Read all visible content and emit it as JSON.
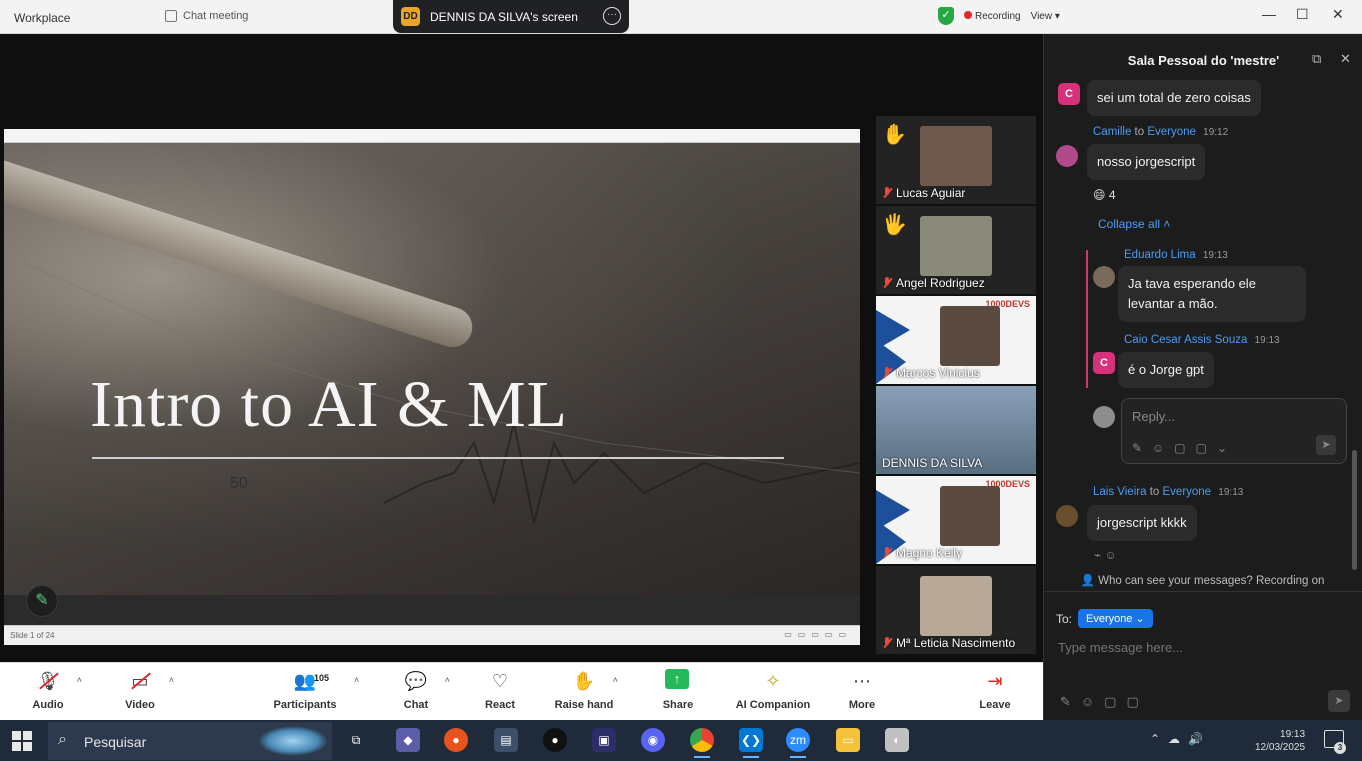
{
  "titlebar": {
    "app_name": "Workplace",
    "meeting_label": "Chat meeting",
    "share_initials": "DD",
    "share_title": "DENNIS DA SILVA's screen",
    "recording_label": "Recording",
    "view_label": "View",
    "shield_color": "#28a745"
  },
  "slide": {
    "title": "Intro to AI & ML",
    "status_left": "Slide 1 of 24"
  },
  "participants": [
    {
      "name": "Lucas Aguiar",
      "hand": "✋",
      "muted": true,
      "type": "photo",
      "photo_color": "#6d5a4c"
    },
    {
      "name": "Angel Rodriguez",
      "hand": "🖐",
      "muted": true,
      "type": "photo",
      "photo_color": "#8a8a7a"
    },
    {
      "name": "Marcos Vinicius",
      "hand": "",
      "muted": true,
      "type": "banner",
      "logo": "1000DEVS"
    },
    {
      "name": "DENNIS DA SILVA",
      "hand": "",
      "muted": false,
      "type": "photo",
      "photo_color": "#5a6e82",
      "active": true
    },
    {
      "name": "Magno Kelly",
      "hand": "",
      "muted": true,
      "type": "banner",
      "logo": "1000DEVS"
    },
    {
      "name": "Mª Leticia Nascimento",
      "hand": "",
      "muted": true,
      "type": "photo",
      "photo_color": "#b8a898"
    }
  ],
  "toolbar": {
    "audio": "Audio",
    "video": "Video",
    "participants": "Participants",
    "participants_count": "105",
    "chat": "Chat",
    "react": "React",
    "raise_hand": "Raise hand",
    "share": "Share",
    "ai": "AI Companion",
    "more": "More",
    "leave": "Leave"
  },
  "chat": {
    "title": "Sala Pessoal do 'mestre'",
    "messages": {
      "m1": {
        "text": "sei um total de zero coisas",
        "avatar": "C"
      },
      "m2": {
        "sender": "Camille",
        "to_word": "to",
        "to": "Everyone",
        "time": "19:12",
        "text": "nosso jorgescript",
        "reaction": "😄 4"
      },
      "collapse": "Collapse all ˄",
      "m3": {
        "sender": "Eduardo Lima",
        "time": "19:13",
        "text": "Ja tava esperando ele levantar a mão."
      },
      "m4": {
        "sender": "Caio Cesar Assis Souza",
        "time": "19:13",
        "text": "é o Jorge gpt",
        "avatar": "C"
      },
      "reply_placeholder": "Reply...",
      "m5": {
        "sender": "Lais Vieira",
        "to_word": "to",
        "to": "Everyone",
        "time": "19:13",
        "text": "jorgescript kkkk"
      }
    },
    "notice": "Who can see your messages? Recording on",
    "to_label": "To:",
    "to_value": "Everyone",
    "input_placeholder": "Type message here..."
  },
  "taskbar": {
    "search_placeholder": "Pesquisar",
    "clock_time": "19:13",
    "clock_date": "12/03/2025",
    "notifications": "3"
  }
}
